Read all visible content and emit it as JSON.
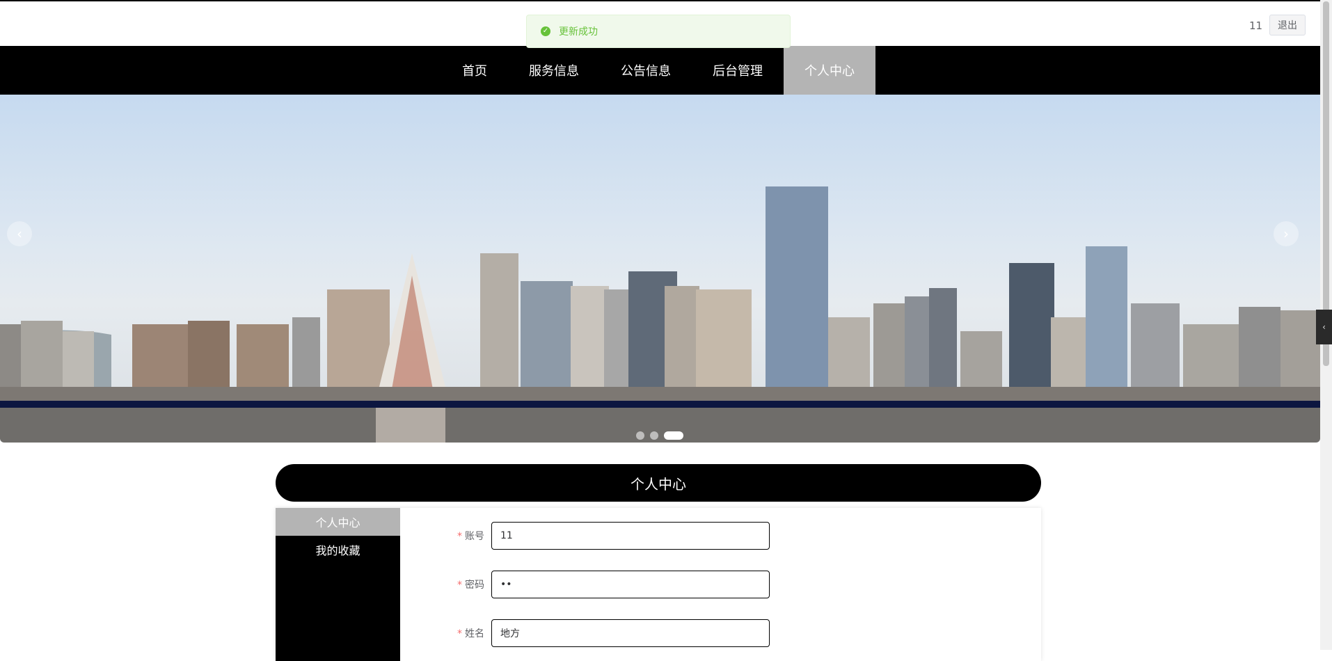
{
  "header": {
    "user_name": "11",
    "logout_label": "退出"
  },
  "toast": {
    "message": "更新成功",
    "icon": "check-circle-icon",
    "color": "#67c23a"
  },
  "nav": {
    "items": [
      {
        "label": "首页",
        "active": false
      },
      {
        "label": "服务信息",
        "active": false
      },
      {
        "label": "公告信息",
        "active": false
      },
      {
        "label": "后台管理",
        "active": false
      },
      {
        "label": "个人中心",
        "active": true
      }
    ]
  },
  "carousel": {
    "prev_icon": "chevron-left-icon",
    "next_icon": "chevron-right-icon",
    "slide_count": 3,
    "active_index": 2
  },
  "section": {
    "title": "个人中心"
  },
  "side_menu": {
    "items": [
      {
        "label": "个人中心",
        "active": true
      },
      {
        "label": "我的收藏",
        "active": false
      }
    ]
  },
  "form": {
    "fields": [
      {
        "label": "账号",
        "value": "11",
        "required": true
      },
      {
        "label": "密码",
        "value": "••",
        "required": true
      },
      {
        "label": "姓名",
        "value": "地方",
        "required": true
      }
    ]
  },
  "colors": {
    "nav_bg": "#000000",
    "nav_active_bg": "#b4b4b4",
    "success": "#67c23a",
    "required": "#f56c6c"
  }
}
